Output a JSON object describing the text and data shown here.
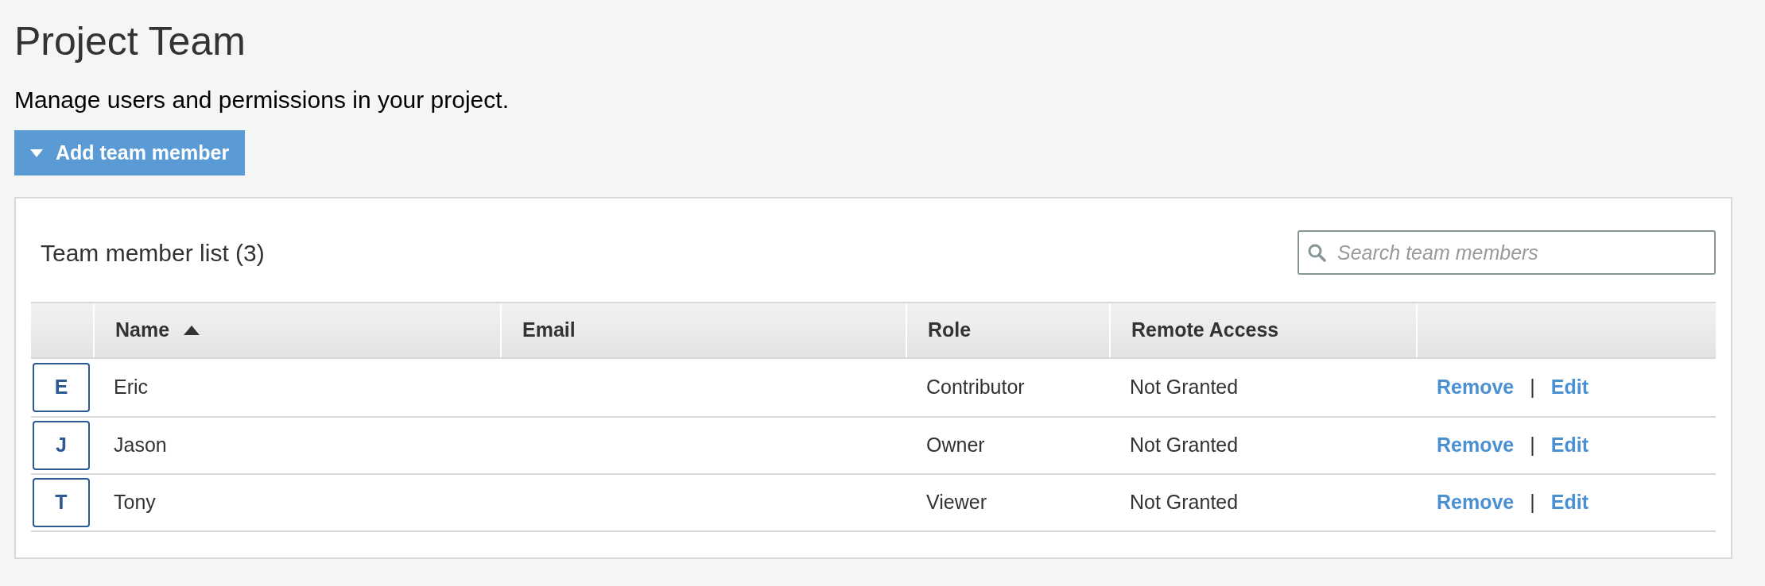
{
  "page": {
    "title": "Project Team",
    "subtitle": "Manage users and permissions in your project."
  },
  "add_button": {
    "label": "Add team member"
  },
  "panel": {
    "title": "Team member list (3)",
    "search": {
      "placeholder": "Search team members"
    }
  },
  "table": {
    "columns": [
      {
        "label": "Name",
        "sorted": true
      },
      {
        "label": "Email",
        "sorted": false
      },
      {
        "label": "Role",
        "sorted": false
      },
      {
        "label": "Remote Access",
        "sorted": false
      }
    ],
    "rows": [
      {
        "initial": "E",
        "name": "Eric",
        "role": "Contributor",
        "remote_access": "Not Granted",
        "actions": [
          "Remove",
          "Edit"
        ],
        "separator": "|"
      },
      {
        "initial": "J",
        "name": "Jason",
        "role": "Owner",
        "remote_access": "Not Granted",
        "actions": [
          "Remove",
          "Edit"
        ],
        "separator": "|"
      },
      {
        "initial": "T",
        "name": "Tony",
        "role": "Viewer",
        "remote_access": "Not Granted",
        "actions": [
          "Remove",
          "Edit"
        ],
        "separator": "|"
      }
    ]
  }
}
